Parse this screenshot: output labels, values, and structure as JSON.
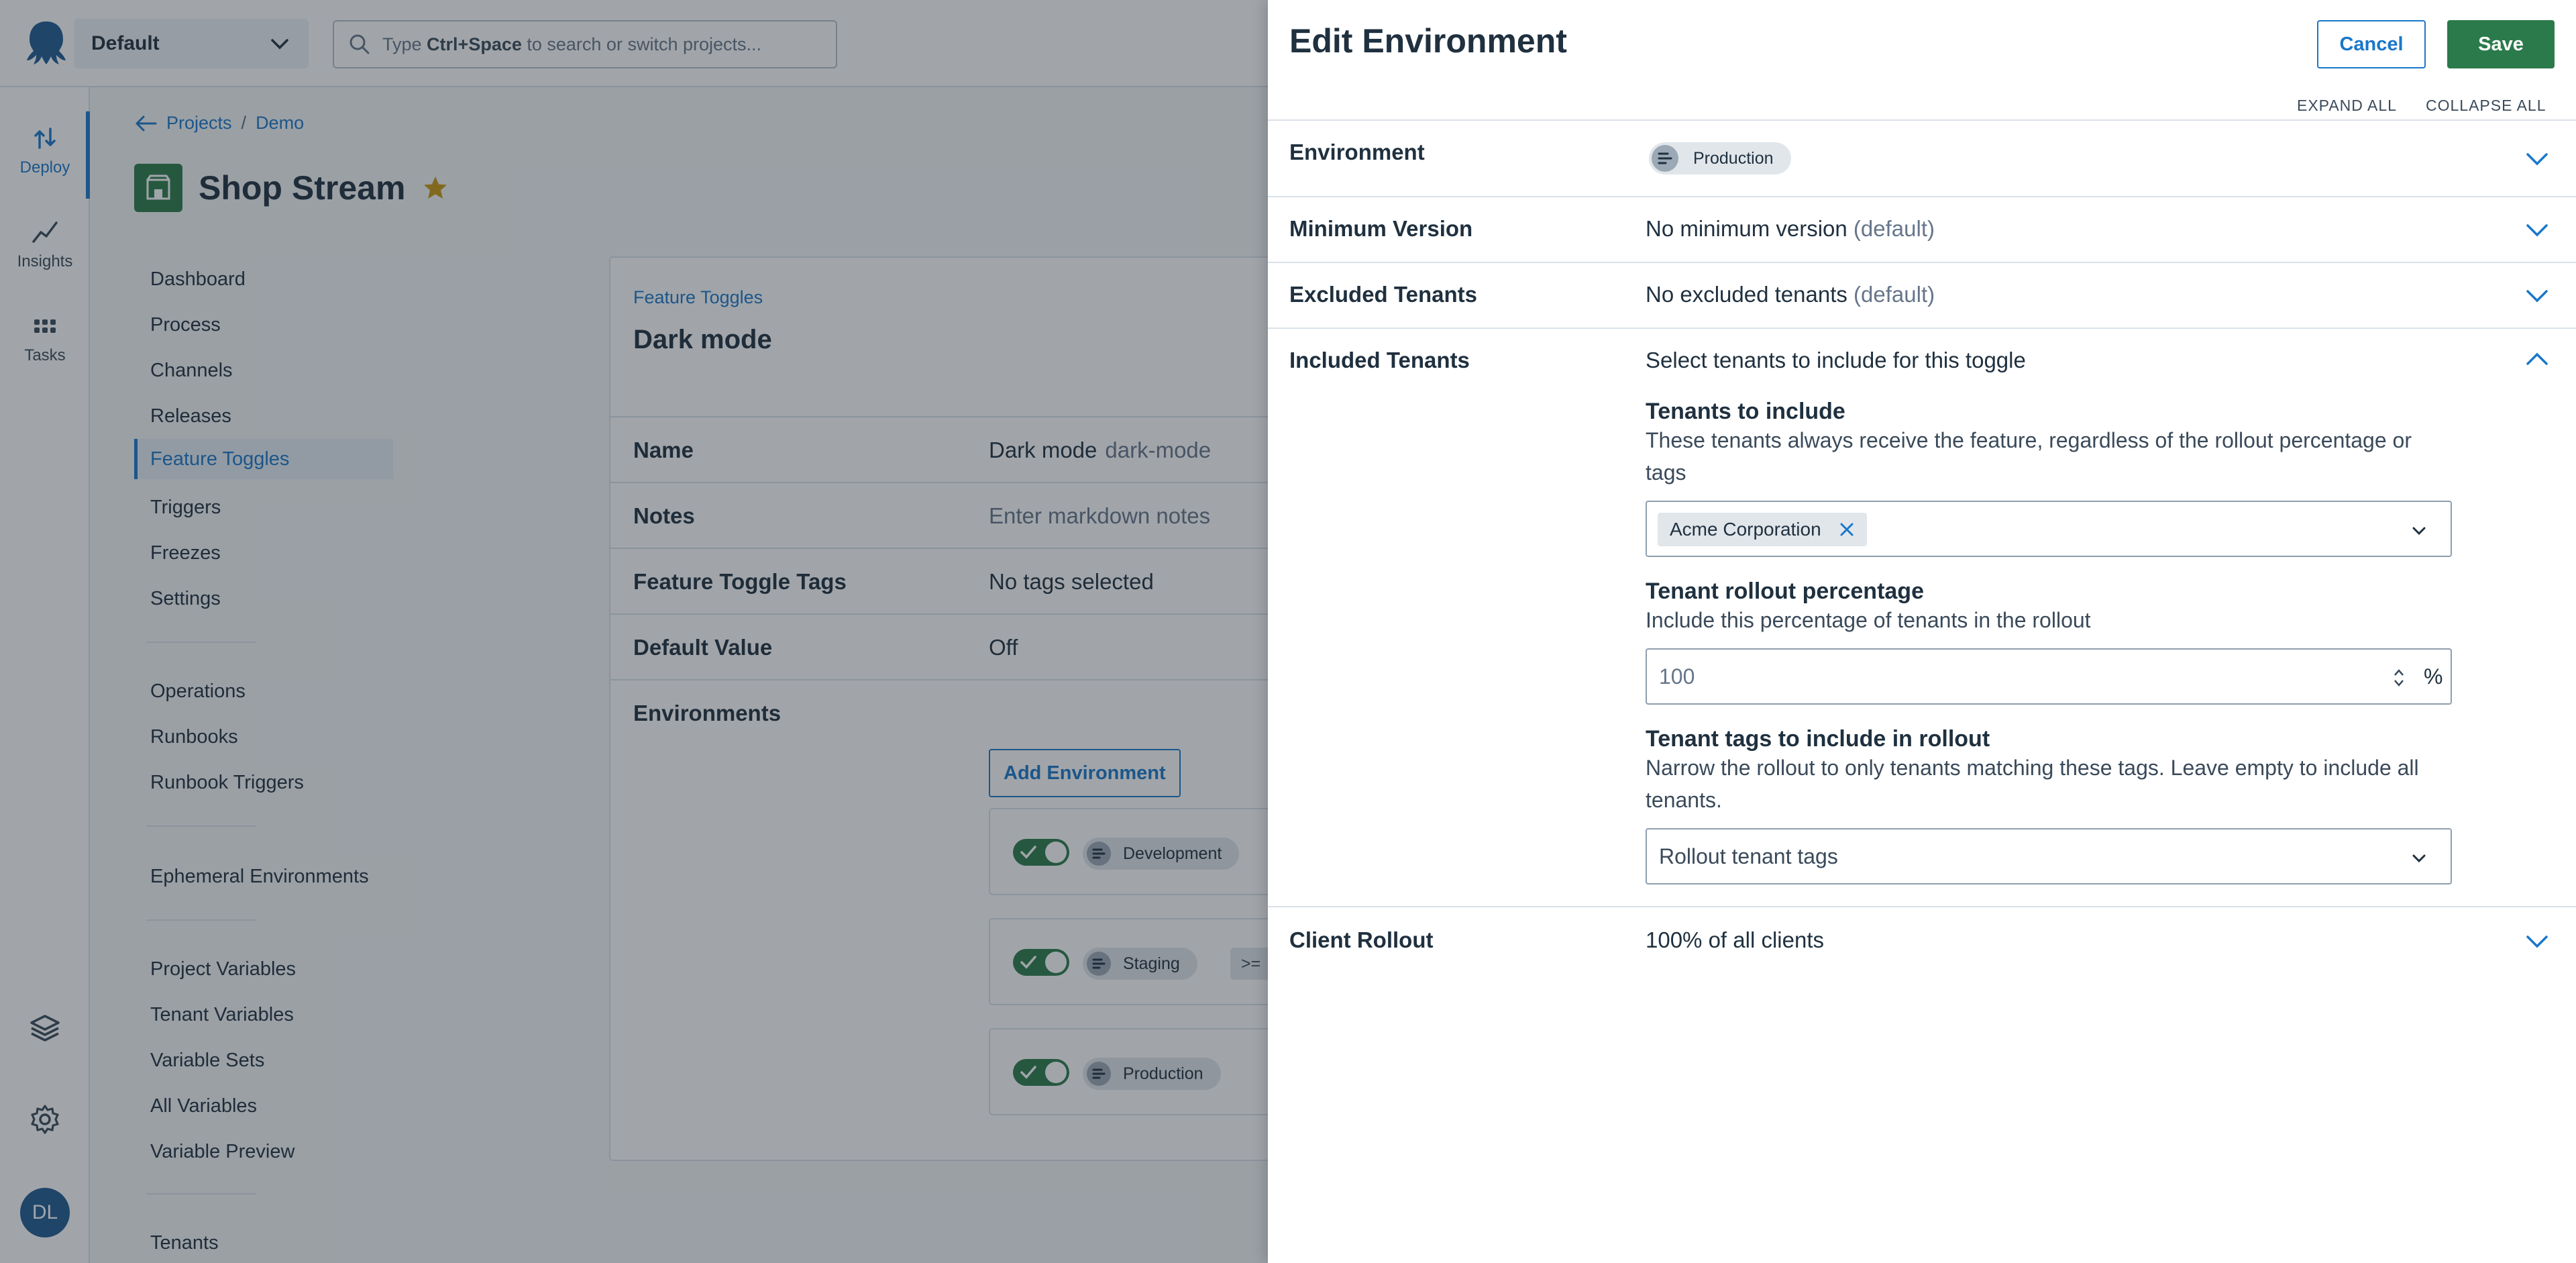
{
  "topbar": {
    "space_name": "Default",
    "search": {
      "prefix": "Type ",
      "shortcut": "Ctrl+Space",
      "suffix": " to search or switch projects..."
    }
  },
  "rail": {
    "items": [
      {
        "label": "Deploy",
        "icon": "deploy-icon"
      },
      {
        "label": "Insights",
        "icon": "insights-icon"
      },
      {
        "label": "Tasks",
        "icon": "tasks-icon"
      }
    ],
    "avatar_initials": "DL"
  },
  "breadcrumb": {
    "projects": "Projects",
    "separator": "/",
    "group": "Demo"
  },
  "project": {
    "title": "Shop Stream"
  },
  "project_nav": {
    "group1": [
      "Dashboard",
      "Process",
      "Channels",
      "Releases",
      "Feature Toggles",
      "Triggers",
      "Freezes",
      "Settings"
    ],
    "group2": [
      "Operations",
      "Runbooks",
      "Runbook Triggers"
    ],
    "group3": [
      "Ephemeral Environments"
    ],
    "group4": [
      "Project Variables",
      "Tenant Variables",
      "Variable Sets",
      "All Variables",
      "Variable Preview"
    ],
    "group5": [
      "Tenants"
    ],
    "active": "Feature Toggles"
  },
  "toggle_detail": {
    "breadcrumb": "Feature Toggles",
    "title": "Dark mode",
    "rows": {
      "name": {
        "label": "Name",
        "value": "Dark mode",
        "slug": "dark-mode"
      },
      "notes": {
        "label": "Notes",
        "placeholder": "Enter markdown notes"
      },
      "tags": {
        "label": "Feature Toggle Tags",
        "value": "No tags selected"
      },
      "default": {
        "label": "Default Value",
        "value": "Off"
      },
      "environments": {
        "label": "Environments"
      }
    },
    "add_environment": "Add Environment",
    "environments": [
      {
        "name": "Development",
        "enabled": true
      },
      {
        "name": "Staging",
        "enabled": true,
        "extra": ">="
      },
      {
        "name": "Production",
        "enabled": true
      }
    ]
  },
  "drawer": {
    "title": "Edit Environment",
    "cancel": "Cancel",
    "save": "Save",
    "expand_all": "EXPAND ALL",
    "collapse_all": "COLLAPSE ALL",
    "sections": {
      "environment": {
        "label": "Environment",
        "chip": "Production"
      },
      "min_version": {
        "label": "Minimum Version",
        "value": "No minimum version",
        "hint": "(default)"
      },
      "excluded": {
        "label": "Excluded Tenants",
        "value": "No excluded tenants",
        "hint": "(default)"
      },
      "included": {
        "label": "Included Tenants",
        "value": "Select tenants to include for this toggle",
        "tenants_heading": "Tenants to include",
        "tenants_help": "These tenants always receive the feature, regardless of the rollout percentage or tags",
        "selected_tenant": "Acme Corporation",
        "pct_heading": "Tenant rollout percentage",
        "pct_help": "Include this percentage of tenants in the rollout",
        "pct_value": "100",
        "pct_unit": "%",
        "tags_heading": "Tenant tags to include in rollout",
        "tags_help": "Narrow the rollout to only tenants matching these tags. Leave empty to include all tenants.",
        "tags_placeholder": "Rollout tenant tags"
      },
      "client_rollout": {
        "label": "Client Rollout",
        "value": "100% of all clients"
      }
    }
  },
  "colors": {
    "accent": "#1a77ca",
    "save_green": "#2b7a4b",
    "text": "#1f303f",
    "border": "#dae2e9"
  }
}
